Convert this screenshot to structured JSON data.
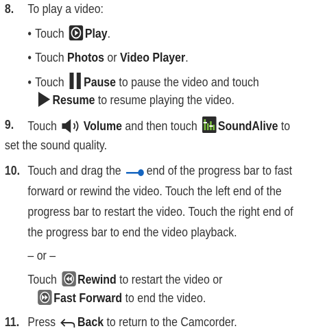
{
  "steps": {
    "s8": {
      "number": "8.",
      "text": "To play a video:",
      "bullet": "•",
      "b1": {
        "pre": "Touch",
        "bold": "Play",
        "post": ".",
        "icon": "play-circle-icon"
      },
      "b2": {
        "pre": "Touch",
        "bold1": "Photos",
        "mid": "or",
        "bold2": "Video Player",
        "post": "."
      },
      "b3": {
        "pre": "Touch",
        "bold": "Pause",
        "post": "to pause the video and touch",
        "icon": "pause-icon"
      },
      "b3cont": {
        "bold": "Resume",
        "post": "to resume playing the video.",
        "icon": "play-arrow-icon"
      }
    },
    "s9": {
      "number": "9.",
      "line1": {
        "pre": "Touch",
        "bold1": "Volume",
        "mid": "and then touch",
        "bold2": "SoundAlive",
        "post": "to",
        "icons": [
          "volume-icon",
          "soundalive-icon"
        ]
      },
      "line2": "set the sound quality."
    },
    "s10": {
      "number": "10.",
      "line1": {
        "pre": "Touch and drag the",
        "post": "end of the progress bar to fast",
        "icon": "progress-slider-icon"
      },
      "line2": "forward or rewind the video. Touch the left end of the",
      "line3": "progress bar to restart the video. Touch the right end of",
      "line4": "the progress bar to end the video playback.",
      "or": "– or –",
      "rewind": {
        "pre": "Touch",
        "bold": "Rewind",
        "post": "to restart the video or",
        "icon": "rewind-icon"
      },
      "ff": {
        "bold": "Fast Forward",
        "post": "to end the video.",
        "icon": "fast-forward-icon"
      }
    },
    "s11": {
      "number": "11.",
      "line": {
        "pre": "Press",
        "bold": "Back",
        "post": "to return to the Camcorder.",
        "icon": "back-icon"
      }
    }
  },
  "colors": {
    "text": "#333333",
    "accent_blue": "#1565c0",
    "icon_dark": "#2b2b2b",
    "icon_gray": "#6d6d6d",
    "soundalive_green": "#7cbf3f"
  }
}
